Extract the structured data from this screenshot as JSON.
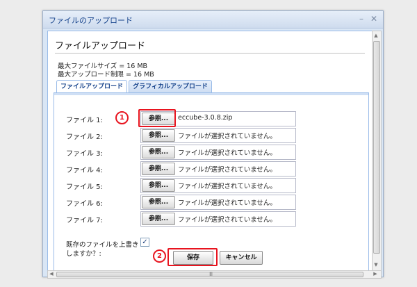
{
  "window": {
    "title": "ファイルのアップロード",
    "minimize_glyph": "–",
    "close_glyph": "✕"
  },
  "page": {
    "heading": "ファイルアップロード",
    "max_file_size": "最大ファイルサイズ = 16 MB",
    "max_upload_limit": "最大アップロード制限 = 16 MB"
  },
  "tabs": [
    {
      "label": "ファイルアップロード",
      "active": true
    },
    {
      "label": "グラフィカルアップロード",
      "active": false
    }
  ],
  "files": [
    {
      "label": "ファイル 1:",
      "button": "参照...",
      "status": "eccube-3.0.8.zip"
    },
    {
      "label": "ファイル 2:",
      "button": "参照...",
      "status": "ファイルが選択されていません。"
    },
    {
      "label": "ファイル 3:",
      "button": "参照...",
      "status": "ファイルが選択されていません。"
    },
    {
      "label": "ファイル 4:",
      "button": "参照...",
      "status": "ファイルが選択されていません。"
    },
    {
      "label": "ファイル 5:",
      "button": "参照...",
      "status": "ファイルが選択されていません。"
    },
    {
      "label": "ファイル 6:",
      "button": "参照...",
      "status": "ファイルが選択されていません。"
    },
    {
      "label": "ファイル 7:",
      "button": "参照...",
      "status": "ファイルが選択されていません。"
    }
  ],
  "overwrite": {
    "label": "既存のファイルを上書きしますか？:",
    "checked": true,
    "check_glyph": "✓"
  },
  "actions": {
    "save": "保存",
    "cancel": "キャンセル"
  },
  "annotations": {
    "step1": "1",
    "step2": "2",
    "highlight_color": "#e8141f"
  },
  "scroll": {
    "up_glyph": "▲",
    "down_glyph": "▼",
    "left_glyph": "◀",
    "right_glyph": "▶",
    "grip": "III"
  }
}
